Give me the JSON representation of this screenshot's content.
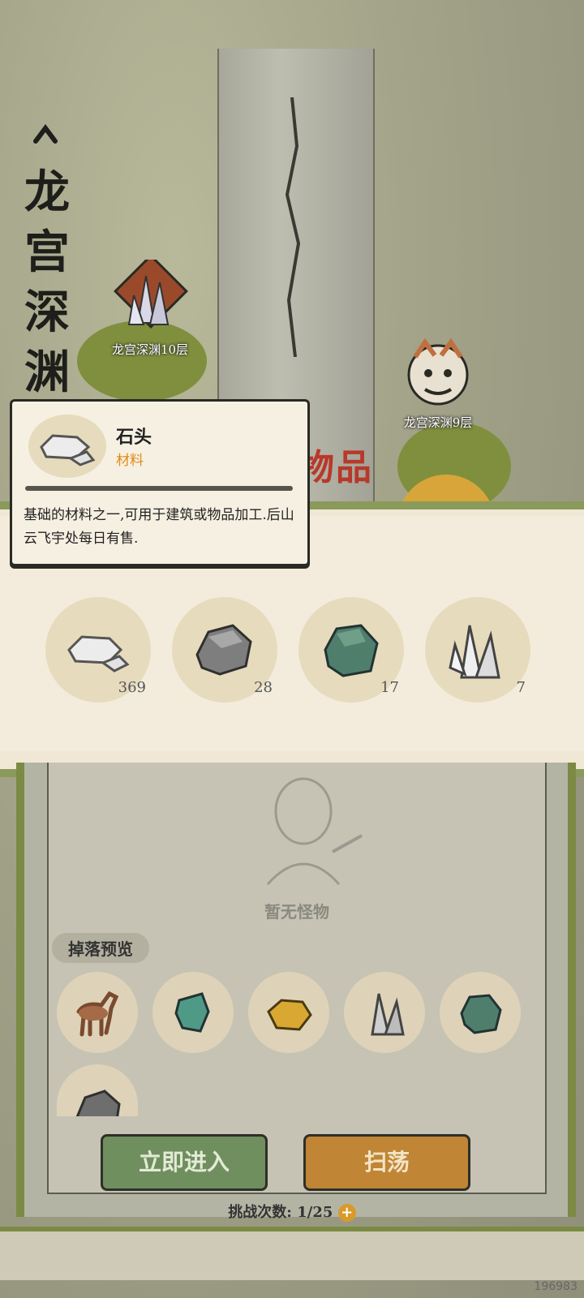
{
  "map": {
    "vertical_title": [
      "龙",
      "宫",
      "深",
      "渊"
    ],
    "nodes": [
      {
        "label": "龙宫深渊10层"
      },
      {
        "label": "龙宫深渊9层"
      }
    ],
    "partial_banner": "物品"
  },
  "tooltip": {
    "name": "石头",
    "type": "材料",
    "description": "基础的材料之一,可用于建筑或物品加工.后山云飞宇处每日有售."
  },
  "items": [
    {
      "icon": "stone-icon",
      "count": "369"
    },
    {
      "icon": "rock-icon",
      "count": "28"
    },
    {
      "icon": "green-ore-icon",
      "count": "17"
    },
    {
      "icon": "crystal-icon",
      "count": "7"
    }
  ],
  "panel": {
    "no_monster": "暂无怪物",
    "drop_title": "掉落预览",
    "drops": [
      {
        "icon": "horse-icon"
      },
      {
        "icon": "jade-icon"
      },
      {
        "icon": "gold-ore-icon"
      },
      {
        "icon": "crystal-icon"
      },
      {
        "icon": "green-ore-icon"
      },
      {
        "icon": "rock-icon"
      }
    ]
  },
  "buttons": {
    "enter": "立即进入",
    "sweep": "扫荡"
  },
  "challenge": {
    "label": "挑战次数:",
    "value": "1/25"
  },
  "build_id": "196983",
  "colors": {
    "accent_green": "#7b8a44",
    "accent_orange": "#c08535",
    "type_orange": "#e08a18"
  }
}
